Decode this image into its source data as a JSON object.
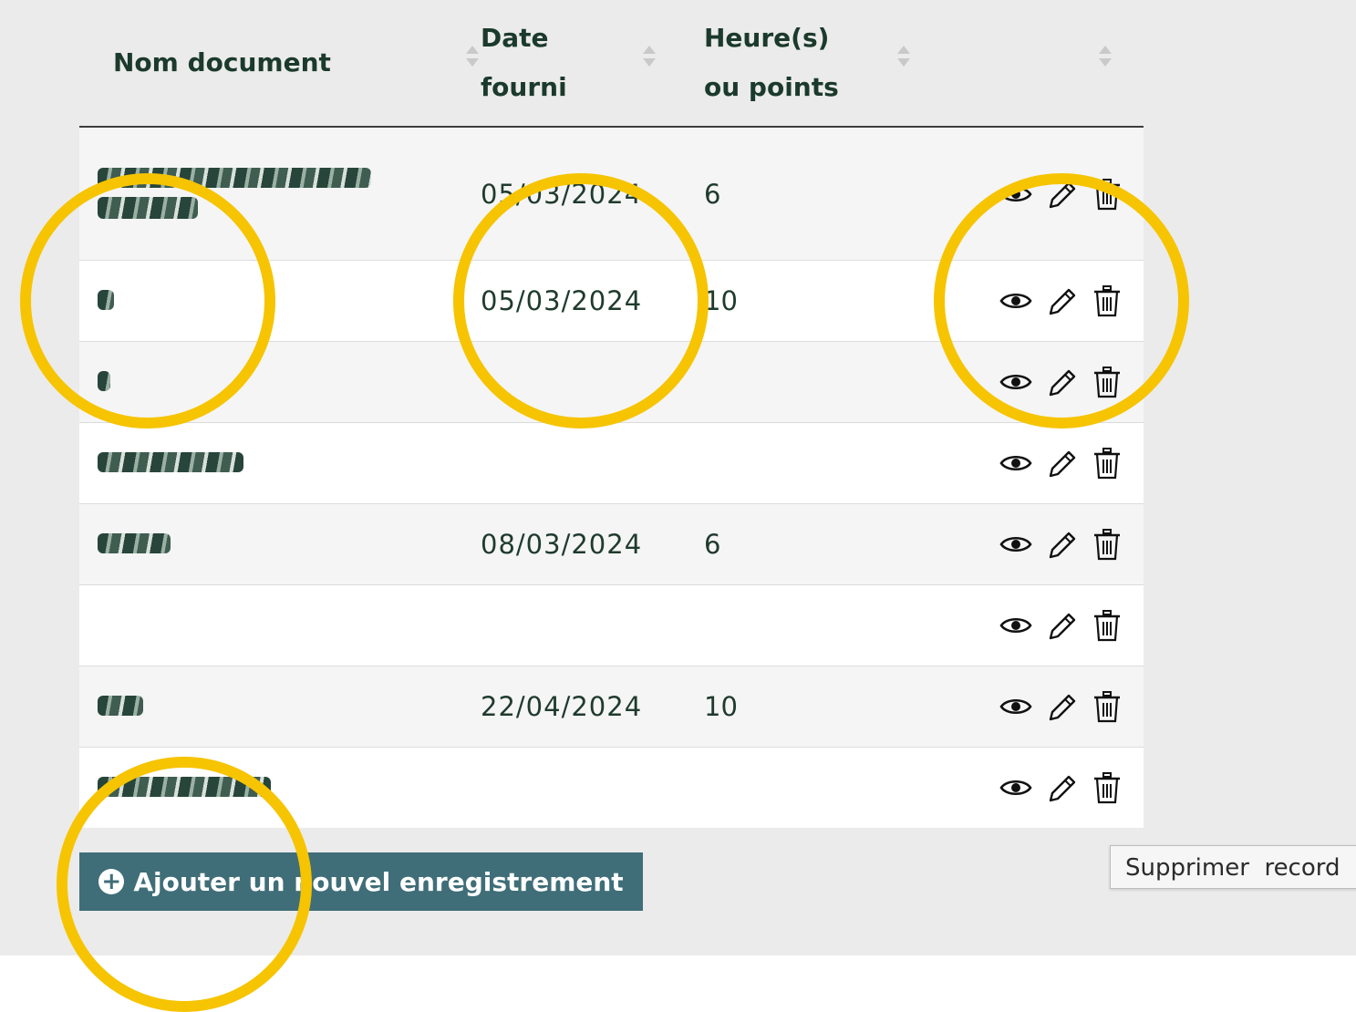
{
  "table": {
    "headers": {
      "name": "Nom document",
      "date_line1": "Date",
      "date_line2": "fourni",
      "points_line1": "Heure(s)",
      "points_line2": "ou points"
    },
    "rows": [
      {
        "date": "05/03/2024",
        "points": "6"
      },
      {
        "date": "05/03/2024",
        "points": "10"
      },
      {
        "date": "",
        "points": ""
      },
      {
        "date": "",
        "points": ""
      },
      {
        "date": "08/03/2024",
        "points": "6"
      },
      {
        "date": "",
        "points": ""
      },
      {
        "date": "22/04/2024",
        "points": "10"
      },
      {
        "date": "",
        "points": ""
      }
    ],
    "row_icons": [
      "eye-icon",
      "pencil-icon",
      "trash-icon"
    ]
  },
  "add_button": {
    "label": "Ajouter un nouvel enregistrement",
    "icon": "plus-circle-icon"
  },
  "tooltip": {
    "text": "Supprimer  record"
  },
  "colors": {
    "header_text": "#1b3a2c",
    "button_bg": "#3f6e78",
    "highlight_ring": "#f6c400"
  }
}
